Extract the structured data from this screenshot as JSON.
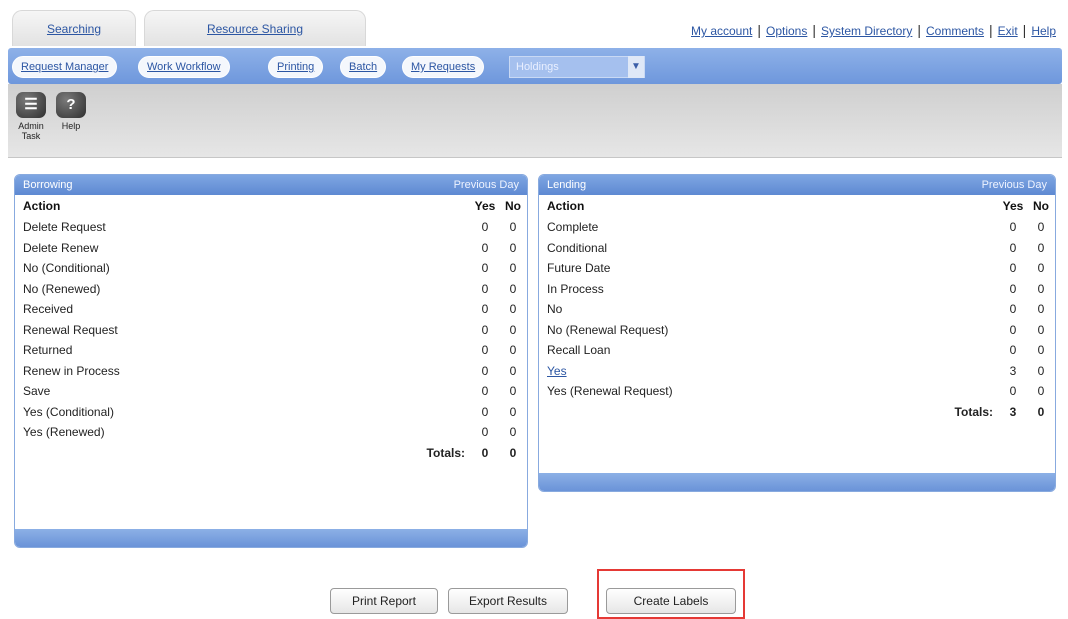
{
  "top_tabs": {
    "searching": "Searching",
    "resource_sharing": "Resource Sharing"
  },
  "top_links": [
    "My account",
    "Options",
    "System Directory",
    "Comments",
    "Exit",
    "Help"
  ],
  "subnav": {
    "buttons": [
      "Request Manager",
      "Work Workflow",
      "Printing",
      "Batch",
      "My Requests"
    ],
    "select_value": "Holdings"
  },
  "toolbar": {
    "admin_label": "Admin Task",
    "help_label": "Help"
  },
  "left_panel": {
    "title": "Borrowing",
    "prev_link": "Previous Day",
    "headers": {
      "action": "Action",
      "yes": "Yes",
      "no": "No"
    },
    "rows": [
      {
        "action": "Delete Request",
        "yes": "0",
        "no": "0"
      },
      {
        "action": "Delete Renew",
        "yes": "0",
        "no": "0"
      },
      {
        "action": "No (Conditional)",
        "yes": "0",
        "no": "0"
      },
      {
        "action": "No (Renewed)",
        "yes": "0",
        "no": "0"
      },
      {
        "action": "Received",
        "yes": "0",
        "no": "0"
      },
      {
        "action": "Renewal Request",
        "yes": "0",
        "no": "0"
      },
      {
        "action": "Returned",
        "yes": "0",
        "no": "0"
      },
      {
        "action": "Renew in Process",
        "yes": "0",
        "no": "0"
      },
      {
        "action": "Save",
        "yes": "0",
        "no": "0"
      },
      {
        "action": "Yes (Conditional)",
        "yes": "0",
        "no": "0"
      },
      {
        "action": "Yes (Renewed)",
        "yes": "0",
        "no": "0"
      }
    ],
    "totals": {
      "label": "Totals:",
      "yes": "0",
      "no": "0"
    }
  },
  "right_panel": {
    "title": "Lending",
    "prev_link": "Previous Day",
    "headers": {
      "action": "Action",
      "yes": "Yes",
      "no": "No"
    },
    "rows": [
      {
        "action": "Complete",
        "yes": "0",
        "no": "0",
        "link": false
      },
      {
        "action": "Conditional",
        "yes": "0",
        "no": "0",
        "link": false
      },
      {
        "action": "Future Date",
        "yes": "0",
        "no": "0",
        "link": false
      },
      {
        "action": "In Process",
        "yes": "0",
        "no": "0",
        "link": false
      },
      {
        "action": "No",
        "yes": "0",
        "no": "0",
        "link": false
      },
      {
        "action": "No (Renewal Request)",
        "yes": "0",
        "no": "0",
        "link": false
      },
      {
        "action": "Recall Loan",
        "yes": "0",
        "no": "0",
        "link": false
      },
      {
        "action": "Yes",
        "yes": "3",
        "no": "0",
        "link": true
      },
      {
        "action": "Yes (Renewal Request)",
        "yes": "0",
        "no": "0",
        "link": false
      }
    ],
    "totals": {
      "label": "Totals:",
      "yes": "3",
      "no": "0"
    }
  },
  "actions": {
    "print": "Print Report",
    "export": "Export Results",
    "create_labels": "Create Labels"
  },
  "colors": {
    "nav_blue": "#6e97dc",
    "panel_header": "#5e89d2",
    "link_blue": "#2c56a3",
    "highlight_red": "#e53935"
  }
}
